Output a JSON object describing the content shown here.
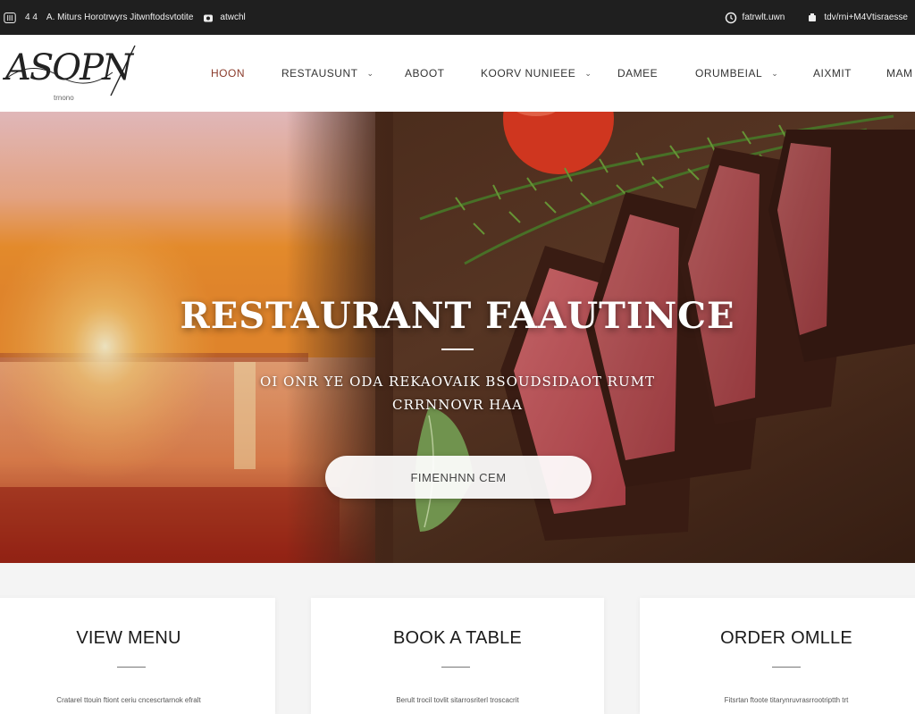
{
  "topbar": {
    "left": [
      {
        "icon": "restaurant-icon",
        "text": ""
      },
      {
        "icon": "",
        "text": "4 4"
      },
      {
        "icon": "",
        "text": "A. Miturs Horotrwyrs Jitwnftodsvtotite"
      },
      {
        "icon": "camera-icon",
        "text": "atwchl"
      }
    ],
    "right": [
      {
        "icon": "clock-icon",
        "text": "fatrwlt.uwn"
      },
      {
        "icon": "phone-icon",
        "text": "tdv/rni+M4Vtisraesse"
      }
    ]
  },
  "header": {
    "logo_text": "ASOPN",
    "logo_sub": "trnono"
  },
  "nav": [
    {
      "label": "HOON",
      "has_dropdown": false,
      "active": true
    },
    {
      "label": "RESTAUSUNT",
      "has_dropdown": true,
      "active": false
    },
    {
      "label": "ABOOT",
      "has_dropdown": false,
      "active": false
    },
    {
      "label": "KOORV NUNIEEE",
      "has_dropdown": true,
      "active": false
    },
    {
      "label": "DAMEE",
      "has_dropdown": false,
      "active": false
    },
    {
      "label": "ORUMBEIAL",
      "has_dropdown": true,
      "active": false
    },
    {
      "label": "AIXMIT",
      "has_dropdown": false,
      "active": false
    },
    {
      "label": "MAM",
      "has_dropdown": false,
      "active": false
    }
  ],
  "hero": {
    "title": "RESTAURANT FAAUTINCE",
    "subtitle_line1": "OI ONR YE ODA REKAOVAIK BSOUDSIDAOT RUMT",
    "subtitle_line2": "CRRNNOVR HAA",
    "button_label": "FIMENHNN CEM"
  },
  "cards": [
    {
      "title": "VIEW MENU",
      "desc": "Cratarel ttouin ftiont ceriu cncescrtarnok efralt"
    },
    {
      "title": "BOOK A TABLE",
      "desc": "Berult trocil tovlit sitarrosriterl troscacrit"
    },
    {
      "title": "ORDER OMLLE",
      "desc": "Fitsrtan ftoote titarynruvrasrrootriptth trt"
    }
  ],
  "colors": {
    "topbar_bg": "#1f1f1f",
    "nav_active": "#8a3a2a",
    "card_bg": "#ffffff",
    "page_bg": "#f4f4f4"
  }
}
